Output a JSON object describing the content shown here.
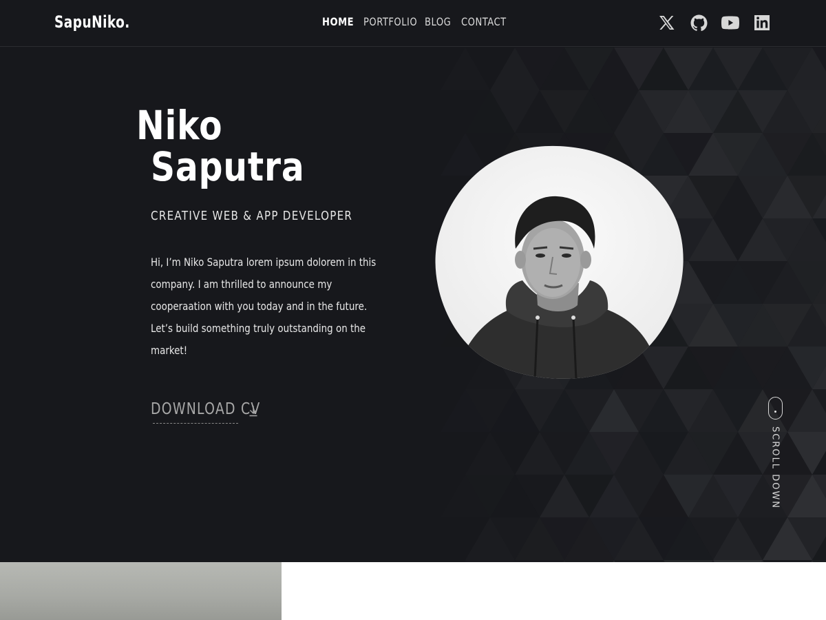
{
  "brand": {
    "logo_text": "SapuNiko."
  },
  "nav": {
    "items": [
      {
        "label": "HOME",
        "active": true
      },
      {
        "label": "PORTFOLIO",
        "active": false
      },
      {
        "label": "BLOG",
        "active": false
      },
      {
        "label": "CONTACT",
        "active": false
      }
    ]
  },
  "social": {
    "icons": [
      "x-twitter-icon",
      "github-icon",
      "youtube-icon",
      "linkedin-icon"
    ]
  },
  "hero": {
    "name_line1": "Niko",
    "name_line2": "Saputra",
    "role": "CREATIVE WEB & APP DEVELOPER",
    "bio": "Hi, I’m Niko Saputra lorem ipsum dolorem in this company. I am thrilled to announce my cooperaation with you today and in the future. Let’s build something truly outstanding on the market!",
    "cta_label": "DOWNLOAD CV",
    "scroll_label": "SCROLL DOWN"
  },
  "colors": {
    "background": "#17181c",
    "text": "#ffffff",
    "muted": "#a8a8a8"
  }
}
